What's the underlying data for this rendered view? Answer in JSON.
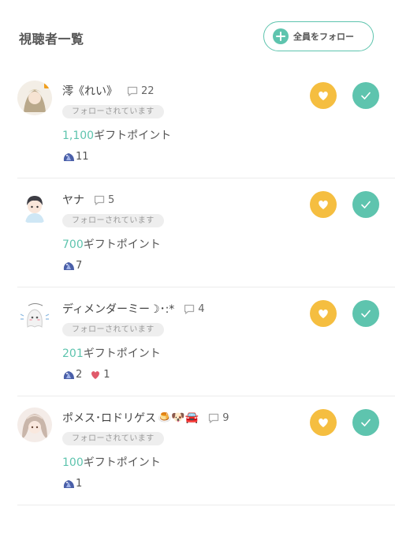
{
  "header": {
    "title": "視聴者一覧",
    "follow_all_label": "全員をフォロー"
  },
  "viewers": [
    {
      "name": "澪《れい》",
      "comments": "22",
      "status": "フォローされています",
      "gift_points": "1,100",
      "gift_suffix": "ギフトポイント",
      "items": [
        {
          "icon": "crystal-icon",
          "count": "11"
        }
      ]
    },
    {
      "name": "ヤナ",
      "comments": "5",
      "status": "フォローされています",
      "gift_points": "700",
      "gift_suffix": "ギフトポイント",
      "items": [
        {
          "icon": "crystal-icon",
          "count": "7"
        }
      ]
    },
    {
      "name": "ディメンダーミー☽･:*",
      "comments": "4",
      "status": "フォローされています",
      "gift_points": "201",
      "gift_suffix": "ギフトポイント",
      "items": [
        {
          "icon": "crystal-icon",
          "count": "2"
        },
        {
          "icon": "heart-small-icon",
          "count": "1"
        }
      ]
    },
    {
      "name": "ポメス･ロドリゲス",
      "name_emojis": "🍮🐶🚘",
      "comments": "9",
      "status": "フォローされています",
      "gift_points": "100",
      "gift_suffix": "ギフトポイント",
      "items": [
        {
          "icon": "crystal-icon",
          "count": "1"
        }
      ]
    }
  ],
  "colors": {
    "accent_green": "#5ec4ae",
    "accent_yellow": "#f5be40",
    "badge_bg": "#eeeeee"
  }
}
